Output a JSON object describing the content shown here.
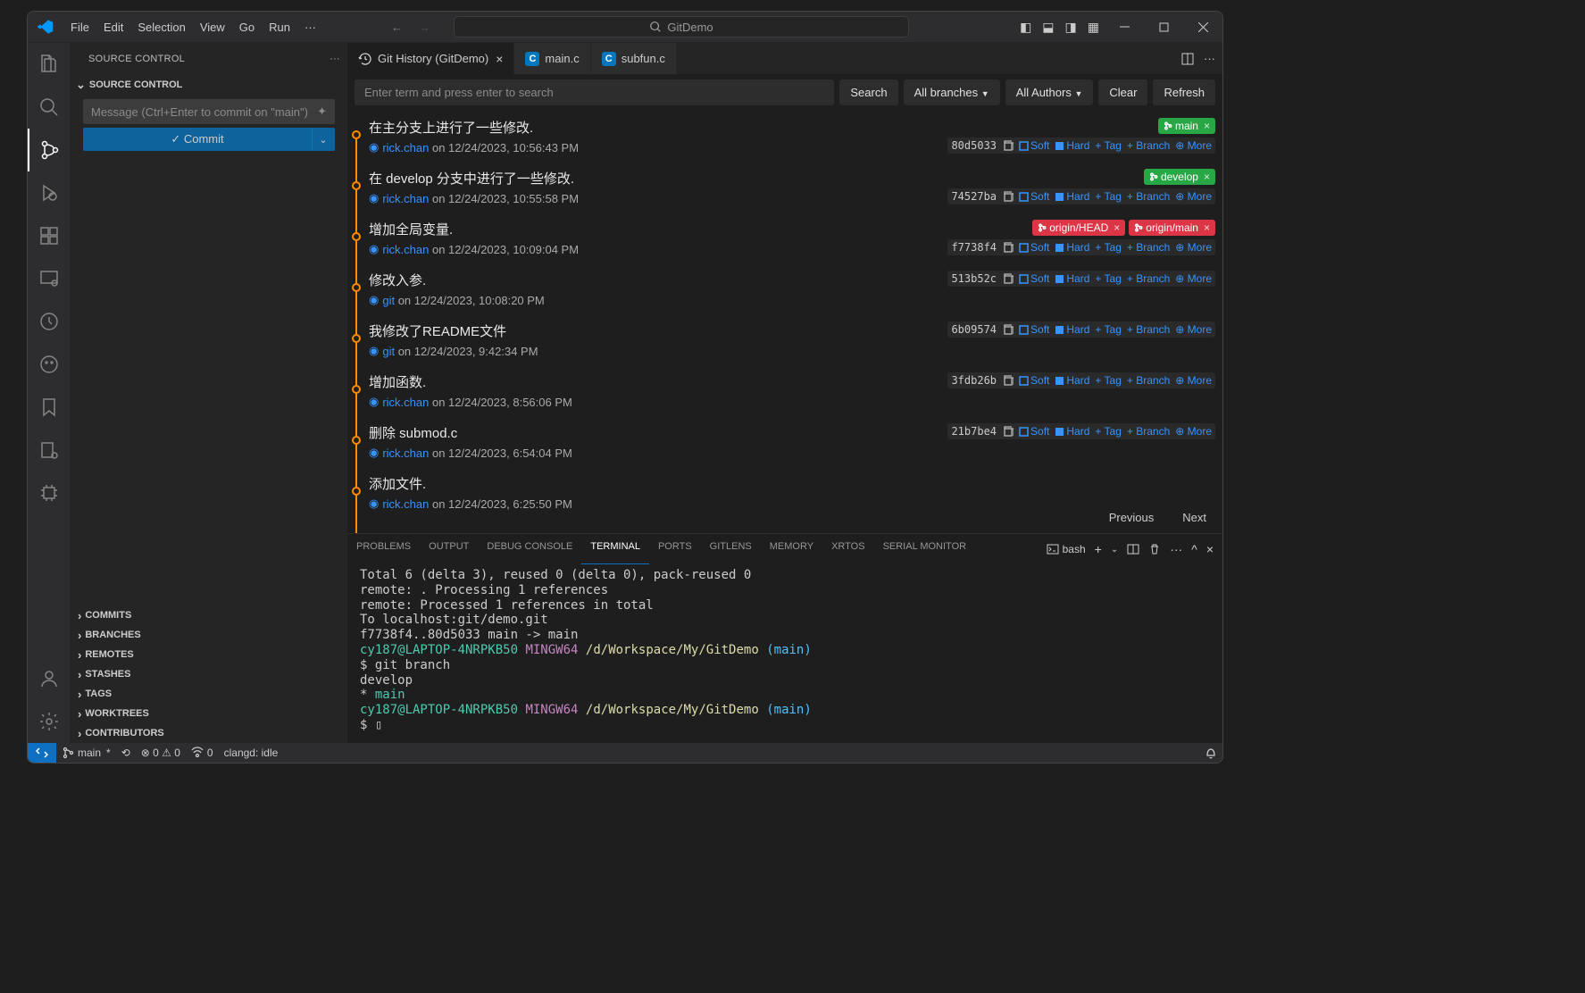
{
  "title": "GitDemo",
  "menu": [
    "File",
    "Edit",
    "Selection",
    "View",
    "Go",
    "Run"
  ],
  "sidebar": {
    "header": "SOURCE CONTROL",
    "section_title": "SOURCE CONTROL",
    "commit_placeholder": "Message (Ctrl+Enter to commit on \"main\")",
    "commit_btn": "✓ Commit",
    "sections": [
      "COMMITS",
      "BRANCHES",
      "REMOTES",
      "STASHES",
      "TAGS",
      "WORKTREES",
      "CONTRIBUTORS"
    ]
  },
  "tabs": [
    {
      "label": "Git History (GitDemo)",
      "icon": "history",
      "active": true,
      "close": true
    },
    {
      "label": "main.c",
      "icon": "C",
      "active": false
    },
    {
      "label": "subfun.c",
      "icon": "C",
      "active": false
    }
  ],
  "githistory": {
    "search_placeholder": "Enter term and press enter to search",
    "btns": {
      "search": "Search",
      "branches": "All branches",
      "authors": "All Authors",
      "clear": "Clear",
      "refresh": "Refresh"
    },
    "pager": {
      "prev": "Previous",
      "next": "Next"
    },
    "actions": {
      "soft": "Soft",
      "hard": "Hard",
      "tag": "Tag",
      "branch": "Branch",
      "more": "More"
    },
    "commits": [
      {
        "msg": "在主分支上进行了一些修改.",
        "author": "rick.chan",
        "date": "12/24/2023, 10:56:43 PM",
        "hash": "80d5033",
        "badges": [
          {
            "text": "main",
            "color": "green",
            "x": true
          }
        ]
      },
      {
        "msg": "在 develop 分支中进行了一些修改.",
        "author": "rick.chan",
        "date": "12/24/2023, 10:55:58 PM",
        "hash": "74527ba",
        "badges": [
          {
            "text": "develop",
            "color": "green",
            "x": true
          }
        ]
      },
      {
        "msg": "增加全局变量.",
        "author": "rick.chan",
        "date": "12/24/2023, 10:09:04 PM",
        "hash": "f7738f4",
        "badges": [
          {
            "text": "origin/HEAD",
            "color": "red",
            "x": true
          },
          {
            "text": "origin/main",
            "color": "red",
            "x": true
          }
        ]
      },
      {
        "msg": "修改入参.",
        "author": "git",
        "date": "12/24/2023, 10:08:20 PM",
        "hash": "513b52c",
        "badges": []
      },
      {
        "msg": "我修改了README文件",
        "author": "git",
        "date": "12/24/2023, 9:42:34 PM",
        "hash": "6b09574",
        "badges": []
      },
      {
        "msg": "增加函数.",
        "author": "rick.chan",
        "date": "12/24/2023, 8:56:06 PM",
        "hash": "3fdb26b",
        "badges": []
      },
      {
        "msg": "删除 submod.c",
        "author": "rick.chan",
        "date": "12/24/2023, 6:54:04 PM",
        "hash": "21b7be4",
        "badges": []
      },
      {
        "msg": "添加文件.",
        "author": "rick.chan",
        "date": "12/24/2023, 6:25:50 PM",
        "hash": "",
        "badges": []
      }
    ]
  },
  "panel": {
    "tabs": [
      "PROBLEMS",
      "OUTPUT",
      "DEBUG CONSOLE",
      "TERMINAL",
      "PORTS",
      "GITLENS",
      "MEMORY",
      "XRTOS",
      "SERIAL MONITOR"
    ],
    "active": "TERMINAL",
    "shell": "bash",
    "lines": [
      {
        "segments": [
          {
            "t": "Total 6 (delta 3), reused 0 (delta 0), pack-reused 0"
          }
        ]
      },
      {
        "segments": [
          {
            "t": "remote: . Processing 1 references"
          }
        ]
      },
      {
        "segments": [
          {
            "t": "remote: Processed 1 references in total"
          }
        ]
      },
      {
        "segments": [
          {
            "t": "To localhost:git/demo.git"
          }
        ]
      },
      {
        "segments": [
          {
            "t": "   f7738f4..80d5033  main -> main"
          }
        ]
      },
      {
        "segments": [
          {
            "t": "cy187@LAPTOP-4NRPKB50",
            "c": "term-green"
          },
          {
            "t": " "
          },
          {
            "t": "MINGW64",
            "c": "term-purple"
          },
          {
            "t": " "
          },
          {
            "t": "/d/Workspace/My/GitDemo",
            "c": "term-yellow"
          },
          {
            "t": " "
          },
          {
            "t": "(main)",
            "c": "term-cyan"
          }
        ]
      },
      {
        "segments": [
          {
            "t": "$ git branch"
          }
        ]
      },
      {
        "segments": [
          {
            "t": "  develop"
          }
        ]
      },
      {
        "segments": [
          {
            "t": "* "
          },
          {
            "t": "main",
            "c": "term-green"
          }
        ]
      },
      {
        "segments": [
          {
            "t": "cy187@LAPTOP-4NRPKB50",
            "c": "term-green"
          },
          {
            "t": " "
          },
          {
            "t": "MINGW64",
            "c": "term-purple"
          },
          {
            "t": " "
          },
          {
            "t": "/d/Workspace/My/GitDemo",
            "c": "term-yellow"
          },
          {
            "t": " "
          },
          {
            "t": "(main)",
            "c": "term-cyan"
          }
        ]
      },
      {
        "segments": [
          {
            "t": "$ "
          },
          {
            "t": "▯"
          }
        ]
      }
    ]
  },
  "status": {
    "branch": "main",
    "sync": "⟲",
    "errors": "⊗ 0 ⚠ 0",
    "radio": "0",
    "clangd": "clangd: idle"
  }
}
